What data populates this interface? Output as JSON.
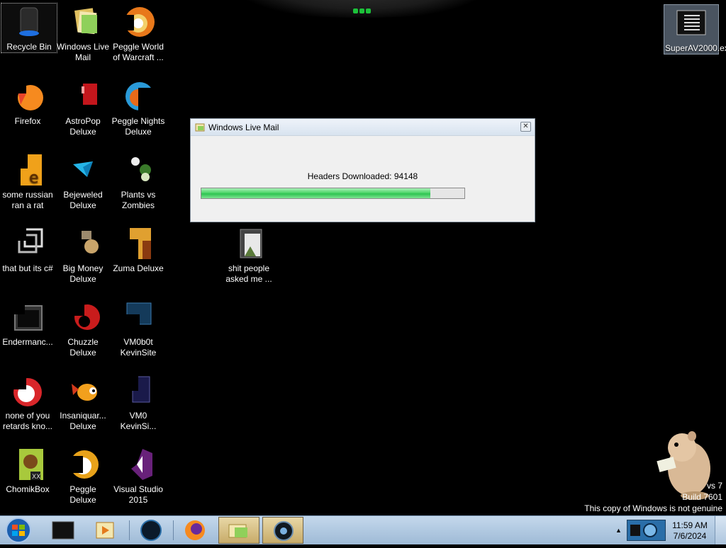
{
  "desktop": {
    "icons": [
      {
        "label": "Recycle Bin"
      },
      {
        "label": "Windows Live Mail"
      },
      {
        "label": "Peggle World of Warcraft ..."
      },
      {
        "label": "Firefox"
      },
      {
        "label": "AstroPop Deluxe"
      },
      {
        "label": "Peggle Nights Deluxe"
      },
      {
        "label": "some russian ran a rat"
      },
      {
        "label": "Bejeweled Deluxe"
      },
      {
        "label": "Plants vs Zombies"
      },
      {
        "label": "that but its c#"
      },
      {
        "label": "Big Money Deluxe"
      },
      {
        "label": "Zuma Deluxe"
      },
      {
        "label": "Endermanc..."
      },
      {
        "label": "Chuzzle Deluxe"
      },
      {
        "label": "VM0b0t KevinSite"
      },
      {
        "label": "none of you retards kno..."
      },
      {
        "label": "Insaniquar... Deluxe"
      },
      {
        "label": "VM0 KevinSi..."
      },
      {
        "label": "ChomikBox"
      },
      {
        "label": "Peggle Deluxe"
      },
      {
        "label": "Visual Studio 2015"
      },
      {
        "label": "shit people asked me ..."
      },
      {
        "label": "SuperAV2000.exe"
      }
    ]
  },
  "dialog": {
    "title": "Windows Live Mail",
    "close_glyph": "✕",
    "status": "Headers Downloaded: 94148",
    "progress": 0.87
  },
  "watermark": {
    "line1": "vs 7",
    "line2": "Build 7601",
    "line3": "This copy of Windows is not genuine"
  },
  "taskbar": {
    "tray_arrow": "▲",
    "time": "11:59 AM",
    "date": "7/6/2024"
  },
  "colors": {
    "progress_green": "#4fd66b",
    "taskbar_bg": "#aec6df"
  }
}
